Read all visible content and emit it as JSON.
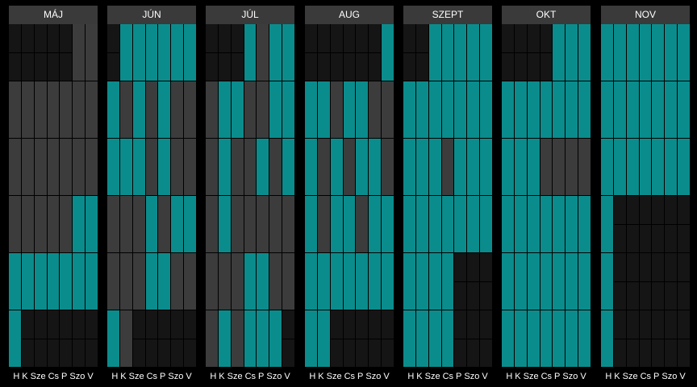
{
  "weekday_labels": [
    "H",
    "K",
    "Sze",
    "Cs",
    "P",
    "Szo",
    "V"
  ],
  "colors": {
    "background": "#000000",
    "header": "#3a3a3a",
    "empty": "#151515",
    "dark": "#3c3c3c",
    "teal": "#0b8c8c"
  },
  "months": [
    {
      "label": "MÁJ",
      "weeks": [
        [
          "empty",
          "empty",
          "empty",
          "empty",
          "empty",
          "dark",
          "dark"
        ],
        [
          "dark",
          "dark",
          "dark",
          "dark",
          "dark",
          "dark",
          "dark"
        ],
        [
          "dark",
          "dark",
          "dark",
          "dark",
          "dark",
          "dark",
          "dark"
        ],
        [
          "dark",
          "dark",
          "dark",
          "dark",
          "dark",
          "teal",
          "teal"
        ],
        [
          "teal",
          "teal",
          "teal",
          "teal",
          "teal",
          "teal",
          "teal"
        ],
        [
          "teal",
          "empty",
          "empty",
          "empty",
          "empty",
          "empty",
          "empty"
        ]
      ]
    },
    {
      "label": "JÚN",
      "weeks": [
        [
          "empty",
          "teal",
          "teal",
          "teal",
          "teal",
          "teal",
          "teal"
        ],
        [
          "teal",
          "dark",
          "teal",
          "dark",
          "teal",
          "dark",
          "dark"
        ],
        [
          "teal",
          "teal",
          "teal",
          "dark",
          "teal",
          "dark",
          "dark"
        ],
        [
          "dark",
          "dark",
          "dark",
          "teal",
          "dark",
          "teal",
          "teal"
        ],
        [
          "dark",
          "dark",
          "dark",
          "teal",
          "teal",
          "dark",
          "dark"
        ],
        [
          "teal",
          "dark",
          "empty",
          "empty",
          "empty",
          "empty",
          "empty"
        ]
      ]
    },
    {
      "label": "JÚL",
      "weeks": [
        [
          "empty",
          "empty",
          "empty",
          "teal",
          "dark",
          "teal",
          "teal"
        ],
        [
          "dark",
          "teal",
          "teal",
          "dark",
          "dark",
          "teal",
          "teal"
        ],
        [
          "dark",
          "teal",
          "dark",
          "dark",
          "teal",
          "dark",
          "teal"
        ],
        [
          "dark",
          "teal",
          "dark",
          "dark",
          "dark",
          "dark",
          "dark"
        ],
        [
          "dark",
          "dark",
          "dark",
          "teal",
          "teal",
          "dark",
          "dark"
        ],
        [
          "dark",
          "teal",
          "dark",
          "teal",
          "teal",
          "teal",
          "empty"
        ]
      ]
    },
    {
      "label": "AUG",
      "weeks": [
        [
          "empty",
          "empty",
          "empty",
          "empty",
          "empty",
          "empty",
          "teal"
        ],
        [
          "teal",
          "teal",
          "dark",
          "teal",
          "teal",
          "dark",
          "dark"
        ],
        [
          "teal",
          "dark",
          "teal",
          "dark",
          "teal",
          "teal",
          "dark"
        ],
        [
          "teal",
          "dark",
          "teal",
          "teal",
          "dark",
          "teal",
          "teal"
        ],
        [
          "teal",
          "teal",
          "teal",
          "teal",
          "teal",
          "teal",
          "teal"
        ],
        [
          "teal",
          "teal",
          "empty",
          "empty",
          "empty",
          "empty",
          "empty"
        ]
      ]
    },
    {
      "label": "SZEPT",
      "weeks": [
        [
          "empty",
          "empty",
          "teal",
          "teal",
          "teal",
          "teal",
          "teal"
        ],
        [
          "teal",
          "teal",
          "teal",
          "teal",
          "teal",
          "teal",
          "teal"
        ],
        [
          "teal",
          "teal",
          "teal",
          "dark",
          "teal",
          "teal",
          "teal"
        ],
        [
          "teal",
          "teal",
          "teal",
          "teal",
          "teal",
          "teal",
          "teal"
        ],
        [
          "teal",
          "teal",
          "teal",
          "teal",
          "empty",
          "empty",
          "empty"
        ],
        [
          "teal",
          "teal",
          "teal",
          "teal",
          "empty",
          "empty",
          "empty"
        ]
      ]
    },
    {
      "label": "OKT",
      "weeks": [
        [
          "empty",
          "empty",
          "empty",
          "empty",
          "teal",
          "teal",
          "teal"
        ],
        [
          "teal",
          "teal",
          "teal",
          "teal",
          "teal",
          "teal",
          "teal"
        ],
        [
          "teal",
          "teal",
          "teal",
          "dark",
          "dark",
          "dark",
          "dark"
        ],
        [
          "teal",
          "teal",
          "teal",
          "teal",
          "teal",
          "teal",
          "teal"
        ],
        [
          "teal",
          "teal",
          "teal",
          "teal",
          "teal",
          "teal",
          "teal"
        ],
        [
          "teal",
          "teal",
          "teal",
          "teal",
          "teal",
          "teal",
          "teal"
        ]
      ]
    },
    {
      "label": "NOV",
      "weeks": [
        [
          "teal",
          "teal",
          "teal",
          "teal",
          "teal",
          "teal",
          "teal"
        ],
        [
          "teal",
          "teal",
          "teal",
          "teal",
          "teal",
          "teal",
          "teal"
        ],
        [
          "teal",
          "teal",
          "teal",
          "teal",
          "teal",
          "teal",
          "teal"
        ],
        [
          "teal",
          "empty",
          "empty",
          "empty",
          "empty",
          "empty",
          "empty"
        ],
        [
          "teal",
          "empty",
          "empty",
          "empty",
          "empty",
          "empty",
          "empty"
        ],
        [
          "teal",
          "empty",
          "empty",
          "empty",
          "empty",
          "empty",
          "empty"
        ]
      ]
    }
  ]
}
